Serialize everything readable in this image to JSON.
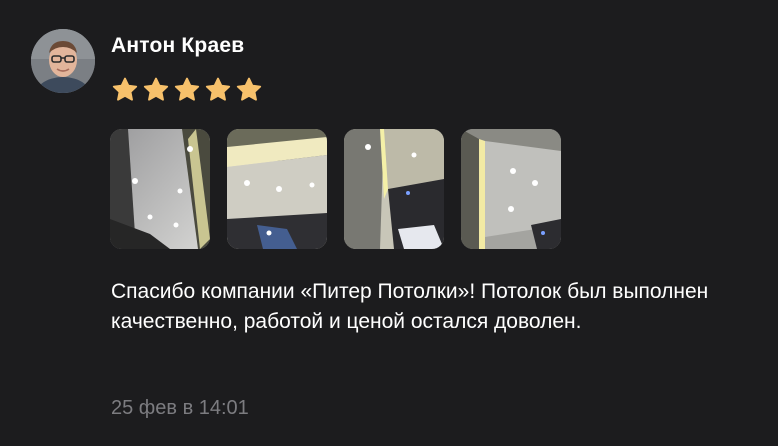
{
  "review": {
    "author_name": "Антон Краев",
    "rating": 5,
    "rating_max": 5,
    "star_color": "#f7c16b",
    "text": "Спасибо компании «Питер Потолки»! Потолок был выполнен качественно, работой и ценой остался доволен.",
    "date": "25 фев в 14:01"
  },
  "photos": [
    {
      "icon": "ceiling-photo-1"
    },
    {
      "icon": "ceiling-photo-2"
    },
    {
      "icon": "ceiling-photo-3"
    },
    {
      "icon": "ceiling-photo-4"
    }
  ],
  "colors": {
    "background": "#1c1c1e",
    "text": "#ffffff",
    "muted": "#7c7c80"
  }
}
